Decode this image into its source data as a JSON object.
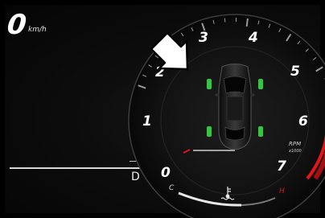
{
  "speedometer": {
    "speed_value": "0",
    "speed_unit": "km/h"
  },
  "gear": {
    "current": "D"
  },
  "tachometer": {
    "scale_labels": [
      "0",
      "1",
      "2",
      "3",
      "4",
      "5",
      "6",
      "7"
    ],
    "rpm_label": "RPM",
    "rpm_multiplier": "x1000",
    "redline_color": "#e0161b"
  },
  "temperature_gauge": {
    "cold_label": "C",
    "hot_label": "H",
    "icon": "coolant-temperature-icon",
    "hot_color": "#e0161b"
  },
  "vehicle_status": {
    "vehicle_icon": "car-top-view-icon",
    "tire_indicator_color": "#31c83e",
    "pointer_icon": "arrow-pointer-icon"
  }
}
